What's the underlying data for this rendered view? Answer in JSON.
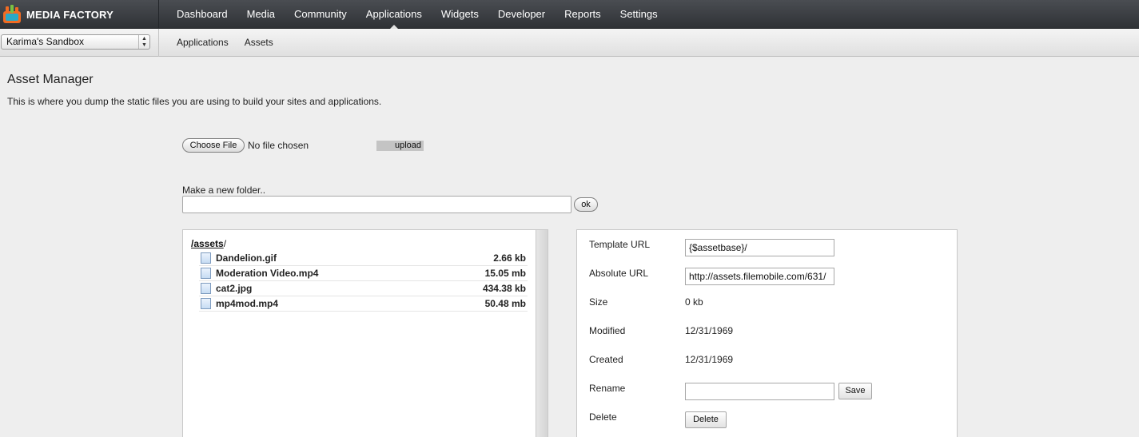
{
  "brand": {
    "name": "MEDIA FACTORY"
  },
  "main_nav": [
    {
      "label": "Dashboard"
    },
    {
      "label": "Media"
    },
    {
      "label": "Community"
    },
    {
      "label": "Applications",
      "active": true
    },
    {
      "label": "Widgets"
    },
    {
      "label": "Developer"
    },
    {
      "label": "Reports"
    },
    {
      "label": "Settings"
    }
  ],
  "site_select": {
    "value": "Karima's Sandbox"
  },
  "sub_nav": [
    {
      "label": "Applications"
    },
    {
      "label": "Assets"
    }
  ],
  "page": {
    "title": "Asset Manager",
    "description": "This is where you dump the static files you are using to build your sites and applications."
  },
  "upload": {
    "choose_label": "Choose File",
    "status": "No file chosen",
    "upload_label": "upload"
  },
  "folder": {
    "label": "Make a new folder..",
    "input_value": "",
    "ok_label": "ok"
  },
  "tree": {
    "root_link": "/assets",
    "root_suffix": "/",
    "files": [
      {
        "name": "Dandelion.gif",
        "size": "2.66 kb"
      },
      {
        "name": "Moderation Video.mp4",
        "size": "15.05 mb"
      },
      {
        "name": "cat2.jpg",
        "size": "434.38 kb"
      },
      {
        "name": "mp4mod.mp4",
        "size": "50.48 mb"
      }
    ]
  },
  "details": {
    "template_url_label": "Template URL",
    "template_url_value": "{$assetbase}/",
    "absolute_url_label": "Absolute URL",
    "absolute_url_value": "http://assets.filemobile.com/631/",
    "size_label": "Size",
    "size_value": "0 kb",
    "modified_label": "Modified",
    "modified_value": "12/31/1969",
    "created_label": "Created",
    "created_value": "12/31/1969",
    "rename_label": "Rename",
    "rename_value": "",
    "save_label": "Save",
    "delete_label": "Delete",
    "delete_button_label": "Delete"
  },
  "colors": {
    "topbar": "#3a3d41",
    "subbar": "#e8e8e8",
    "page_bg": "#eeeeee",
    "logo_orange": "#f26b22",
    "logo_teal": "#29a9c8"
  },
  "icons": {
    "logo": "media-factory-logo-icon",
    "file": "file-icon",
    "select_arrows": "updown-arrows-icon",
    "nav_active_marker": "caret-up-icon"
  }
}
